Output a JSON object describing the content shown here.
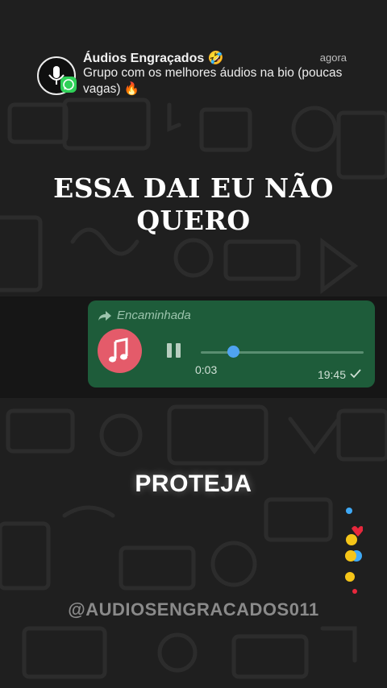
{
  "notification": {
    "app_icon": "microphone-icon",
    "badge_icon": "whatsapp-icon",
    "title": "Áudios Engraçados 🤣",
    "time": "agora",
    "body": "Grupo com os melhores áudios na bio (poucas vagas) 🔥"
  },
  "headline": {
    "line1": "ESSA DAI EU NÃO",
    "line2": "QUERO"
  },
  "voice_message": {
    "forwarded_label": "Encaminhada",
    "avatar_icon": "music-note-icon",
    "control_icon": "pause-icon",
    "progress": 0.2,
    "elapsed": "0:03",
    "timestamp": "19:45",
    "status_icon": "check-icon"
  },
  "caption": "PROTEJA",
  "watermark": "@AUDIOSENGRACADOS011",
  "colors": {
    "background": "#1f1f1f",
    "bubble": "#1e5c3a",
    "avatar": "#e45b6a",
    "progress_thumb": "#4fa3f0",
    "whatsapp_green": "#2fd158"
  }
}
